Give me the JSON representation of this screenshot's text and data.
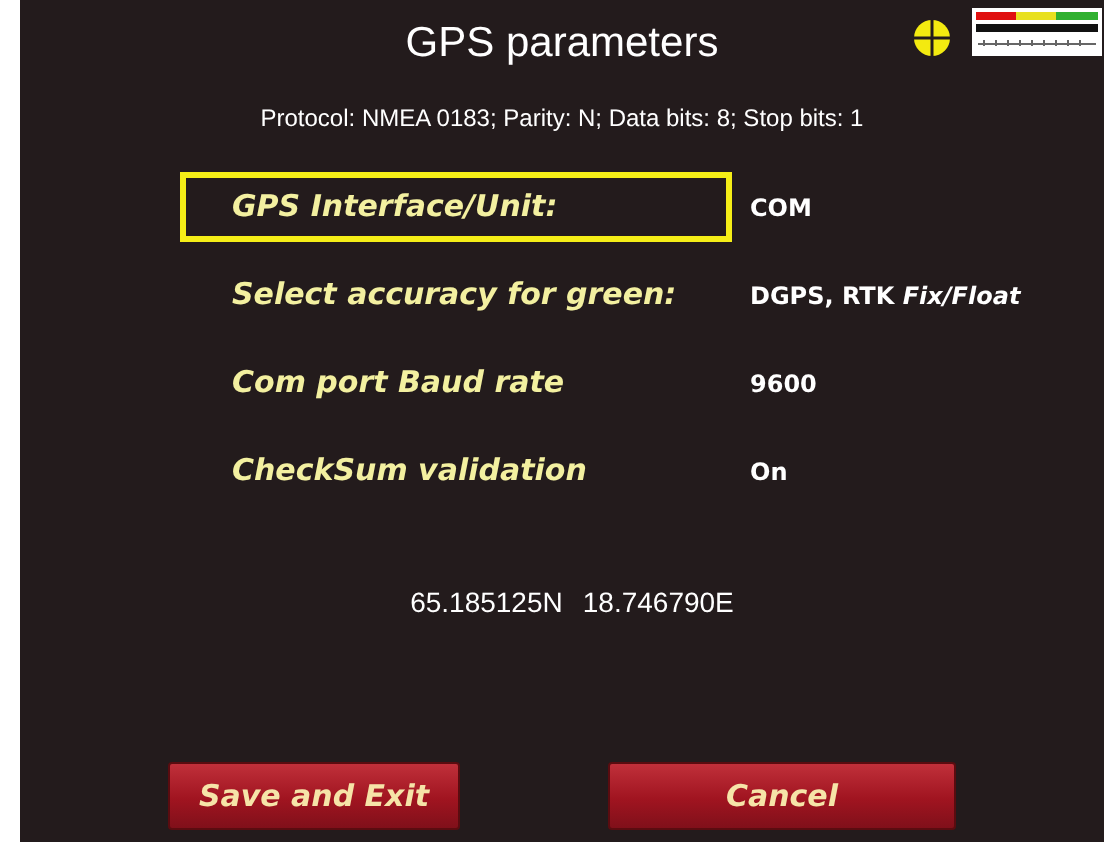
{
  "title": "GPS parameters",
  "protocol": "Protocol: NMEA 0183; Parity: N; Data bits: 8; Stop bits: 1",
  "rows": [
    {
      "label": "GPS Interface/Unit:",
      "value": "COM",
      "selected": true
    },
    {
      "label": "Select accuracy for green:",
      "value": "DGPS, RTK *Fix/Float*",
      "selected": false
    },
    {
      "label": "Com port Baud rate",
      "value": "9600",
      "selected": false
    },
    {
      "label": "CheckSum validation",
      "value": "On",
      "selected": false
    }
  ],
  "coordinates": {
    "latitude": "65.185125N",
    "longitude": "18.746790E"
  },
  "buttons": [
    "Save and Exit",
    "Cancel"
  ]
}
